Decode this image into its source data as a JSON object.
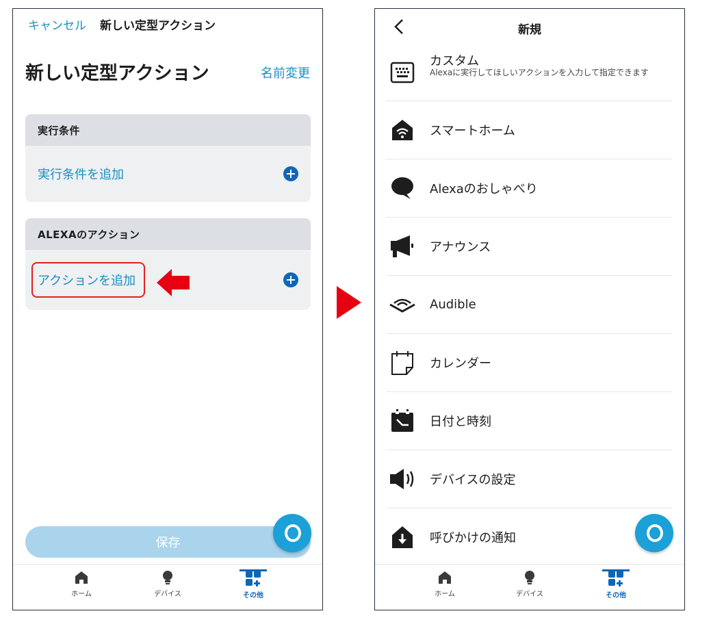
{
  "left": {
    "cancel_label": "キャンセル",
    "top_title": "新しい定型アクション",
    "big_title": "新しい定型アクション",
    "rename_label": "名前変更",
    "conditions": {
      "header": "実行条件",
      "add_label": "実行条件を追加"
    },
    "actions": {
      "header": "ALEXAのアクション",
      "add_label": "アクションを追加"
    },
    "save_label": "保存"
  },
  "nav": {
    "home": "ホーム",
    "devices": "デバイス",
    "more": "その他"
  },
  "right": {
    "title": "新規",
    "items": [
      {
        "label": "カスタム",
        "description": "Alexaに実行してほしいアクションを入力して指定できます",
        "icon": "keyboard-icon"
      },
      {
        "label": "スマートホーム",
        "icon": "smart-home-icon"
      },
      {
        "label": "Alexaのおしゃべり",
        "icon": "speech-bubble-icon"
      },
      {
        "label": "アナウンス",
        "icon": "megaphone-icon"
      },
      {
        "label": "Audible",
        "icon": "audible-icon"
      },
      {
        "label": "カレンダー",
        "icon": "calendar-icon"
      },
      {
        "label": "日付と時刻",
        "icon": "date-time-icon"
      },
      {
        "label": "デバイスの設定",
        "icon": "speaker-icon"
      },
      {
        "label": "呼びかけの通知",
        "icon": "notification-icon"
      }
    ]
  },
  "colors": {
    "accent": "#1a8fc4",
    "primary": "#1066b5",
    "alexa": "#1ba0d7",
    "highlight": "#e02020"
  }
}
